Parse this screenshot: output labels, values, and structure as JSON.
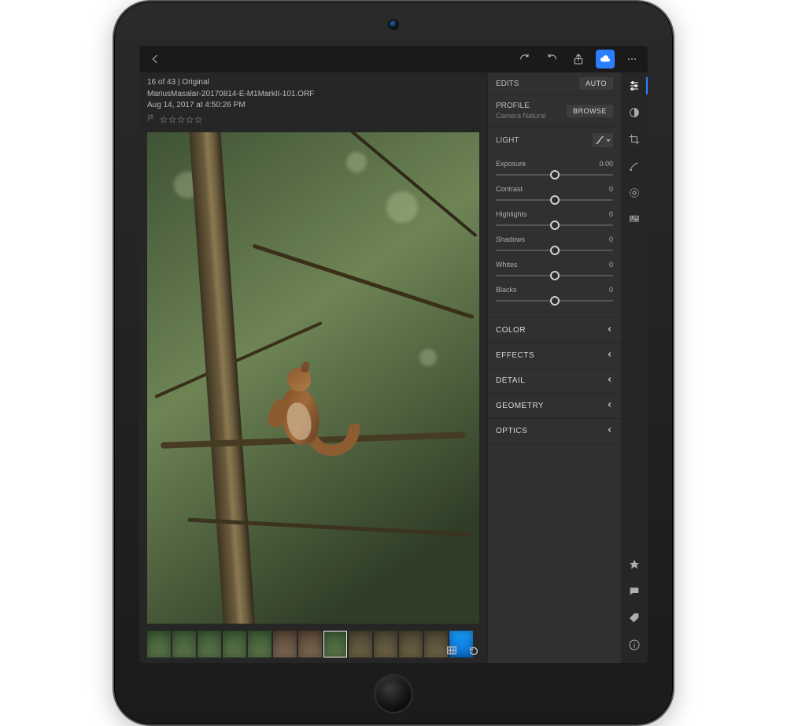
{
  "meta": {
    "counter": "16 of 43 | Original",
    "filename": "MariusMasalar-20170814-E-M1MarkII-101.ORF",
    "datetime": "Aug 14, 2017 at 4:50:26 PM"
  },
  "panel": {
    "edits_label": "EDITS",
    "auto_label": "AUTO",
    "profile_label": "PROFILE",
    "profile_value": "Camera Natural",
    "browse_label": "BROWSE",
    "light_label": "LIGHT",
    "sections": {
      "color": "COLOR",
      "effects": "EFFECTS",
      "detail": "DETAIL",
      "geometry": "GEOMETRY",
      "optics": "OPTICS"
    }
  },
  "sliders": [
    {
      "name": "Exposure",
      "value": "0.00",
      "pos": 50
    },
    {
      "name": "Contrast",
      "value": "0",
      "pos": 50
    },
    {
      "name": "Highlights",
      "value": "0",
      "pos": 50
    },
    {
      "name": "Shadows",
      "value": "0",
      "pos": 50
    },
    {
      "name": "Whites",
      "value": "0",
      "pos": 50
    },
    {
      "name": "Blacks",
      "value": "0",
      "pos": 50
    }
  ]
}
